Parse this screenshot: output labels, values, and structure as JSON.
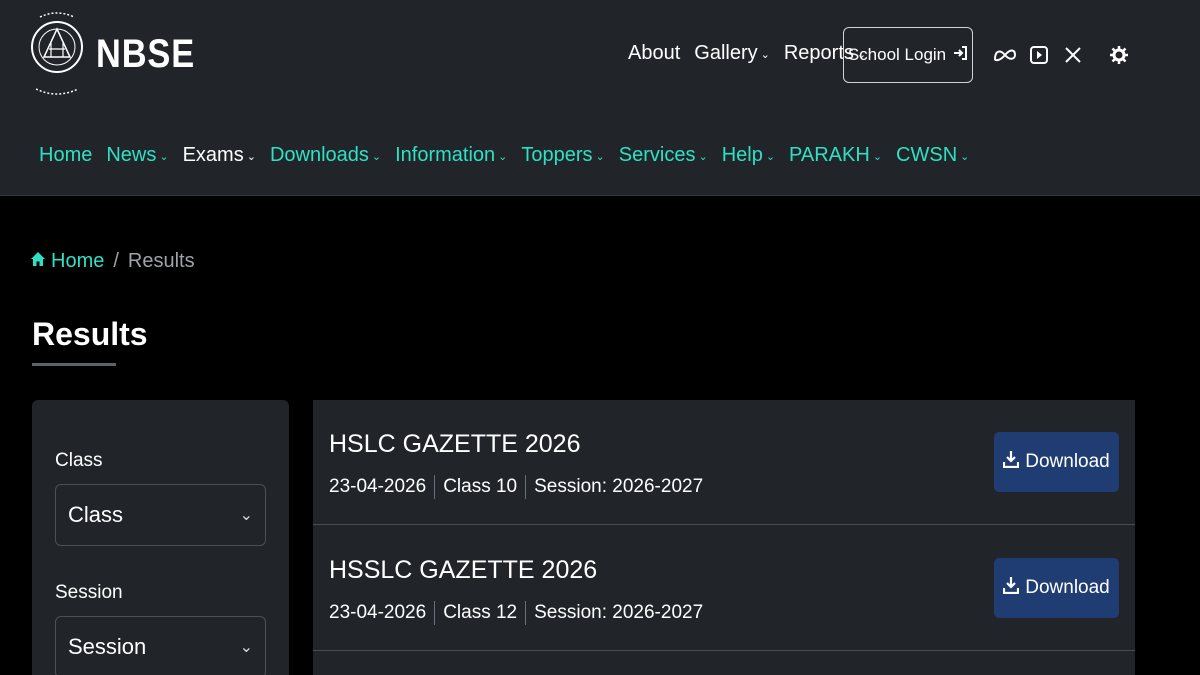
{
  "brand": {
    "name": "NBSE",
    "logo_motto": "labour and honour",
    "logo_ring_text": "NAGALAND BOARD OF SCHOOL EDUCATION"
  },
  "topnav": {
    "items": [
      {
        "label": "About",
        "has_caret": false
      },
      {
        "label": "Gallery",
        "has_caret": true
      },
      {
        "label": "Reports",
        "has_caret": true
      }
    ],
    "login_label": "School Login",
    "icons": [
      "meta-icon",
      "youtube-icon",
      "x-icon",
      "gear-icon"
    ]
  },
  "mainnav": {
    "items": [
      {
        "label": "Home",
        "has_caret": false,
        "active": false
      },
      {
        "label": "News",
        "has_caret": true,
        "active": false
      },
      {
        "label": "Exams",
        "has_caret": true,
        "active": true
      },
      {
        "label": "Downloads",
        "has_caret": true,
        "active": false
      },
      {
        "label": "Information",
        "has_caret": true,
        "active": false
      },
      {
        "label": "Toppers",
        "has_caret": true,
        "active": false
      },
      {
        "label": "Services",
        "has_caret": true,
        "active": false
      },
      {
        "label": "Help",
        "has_caret": true,
        "active": false
      },
      {
        "label": "PARAKH",
        "has_caret": true,
        "active": false
      },
      {
        "label": "CWSN",
        "has_caret": true,
        "active": false
      }
    ]
  },
  "breadcrumb": {
    "home": "Home",
    "separator": "/",
    "current": "Results"
  },
  "page": {
    "title": "Results"
  },
  "filters": {
    "class_label": "Class",
    "class_value": "Class",
    "session_label": "Session",
    "session_value": "Session"
  },
  "results": [
    {
      "title": "HSLC GAZETTE 2026",
      "date": "23-04-2026",
      "class": "Class 10",
      "session": "Session: 2026-2027",
      "button": "Download"
    },
    {
      "title": "HSSLC GAZETTE 2026",
      "date": "23-04-2026",
      "class": "Class 12",
      "session": "Session: 2026-2027",
      "button": "Download"
    }
  ],
  "colors": {
    "header_bg": "#212429",
    "page_bg": "#000000",
    "accent_teal": "#2fe0c4",
    "download_btn": "#1f3d72"
  }
}
